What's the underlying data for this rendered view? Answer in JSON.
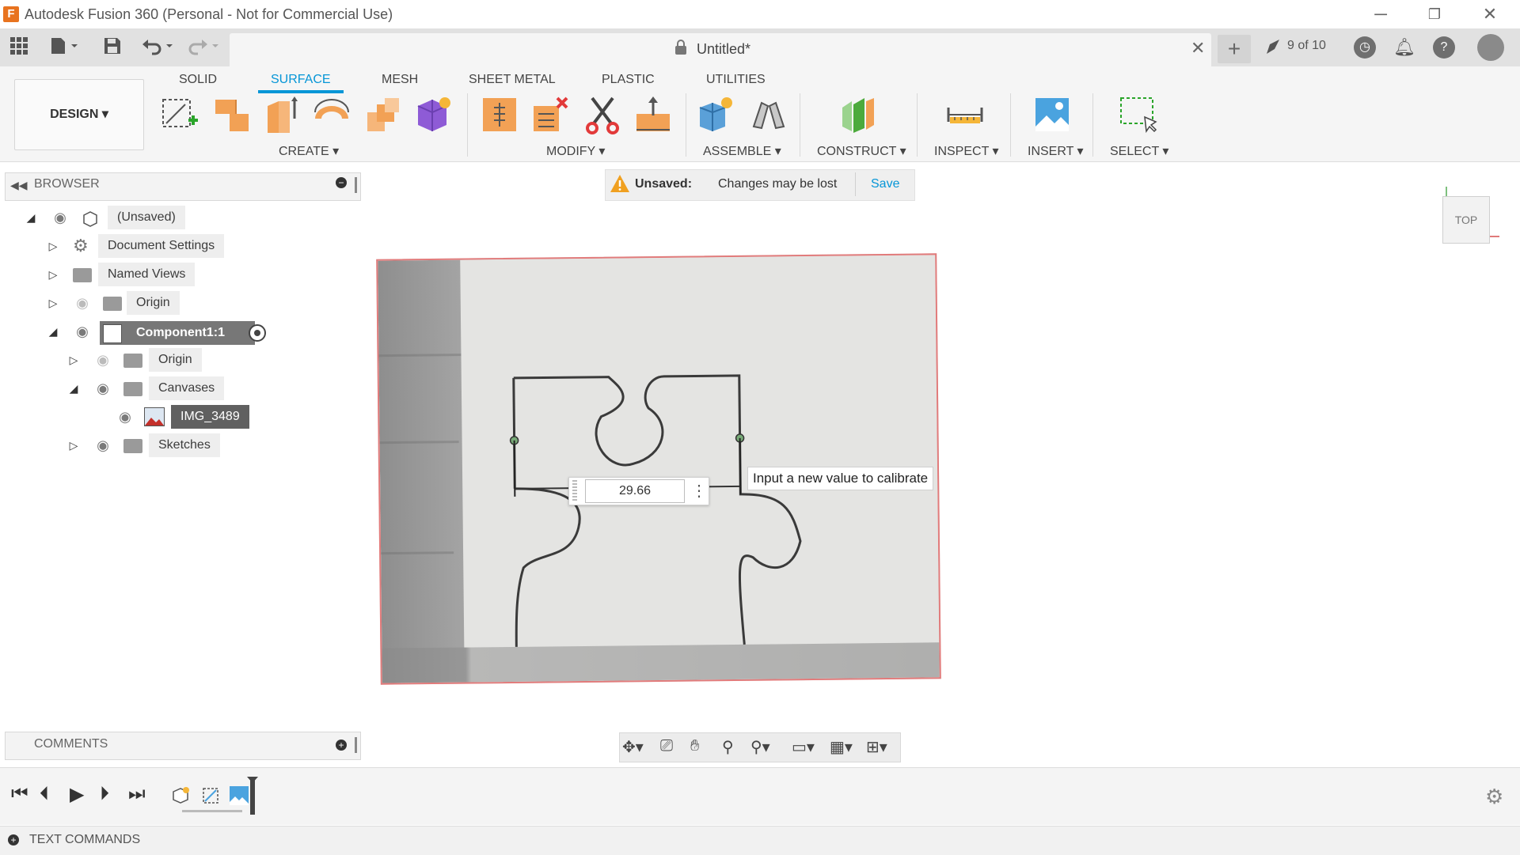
{
  "window": {
    "title": "Autodesk Fusion 360 (Personal - Not for Commercial Use)",
    "logo_letter": "F"
  },
  "doc_tab": {
    "title": "Untitled*",
    "job_status": "9 of 10"
  },
  "ribbon": {
    "workspace": "DESIGN ▾",
    "tabs": [
      "SOLID",
      "SURFACE",
      "MESH",
      "SHEET METAL",
      "PLASTIC",
      "UTILITIES"
    ],
    "active_tab": "SURFACE",
    "groups": {
      "create": "CREATE ▾",
      "modify": "MODIFY ▾",
      "assemble": "ASSEMBLE ▾",
      "construct": "CONSTRUCT ▾",
      "inspect": "INSPECT ▾",
      "insert": "INSERT ▾",
      "select": "SELECT ▾"
    }
  },
  "browser": {
    "title": "BROWSER",
    "items": [
      {
        "label": "(Unsaved)"
      },
      {
        "label": "Document Settings"
      },
      {
        "label": "Named Views"
      },
      {
        "label": "Origin"
      },
      {
        "label": "Component1:1"
      },
      {
        "label": "Origin"
      },
      {
        "label": "Canvases"
      },
      {
        "label": "IMG_3489"
      },
      {
        "label": "Sketches"
      }
    ]
  },
  "unsaved_bar": {
    "status": "Unsaved:",
    "message": "Changes may be lost",
    "save_label": "Save"
  },
  "calibration": {
    "value": "29.66",
    "tooltip": "Input a new value to calibrate"
  },
  "viewcube": {
    "face": "TOP"
  },
  "comments": {
    "title": "COMMENTS"
  },
  "text_commands": {
    "label": "TEXT COMMANDS"
  },
  "colors": {
    "accent": "#0696d7",
    "canvas_border": "#e27b7b",
    "tool_orange": "#f2a155",
    "tool_purple": "#8e5bd6",
    "warning": "#f0a020"
  }
}
